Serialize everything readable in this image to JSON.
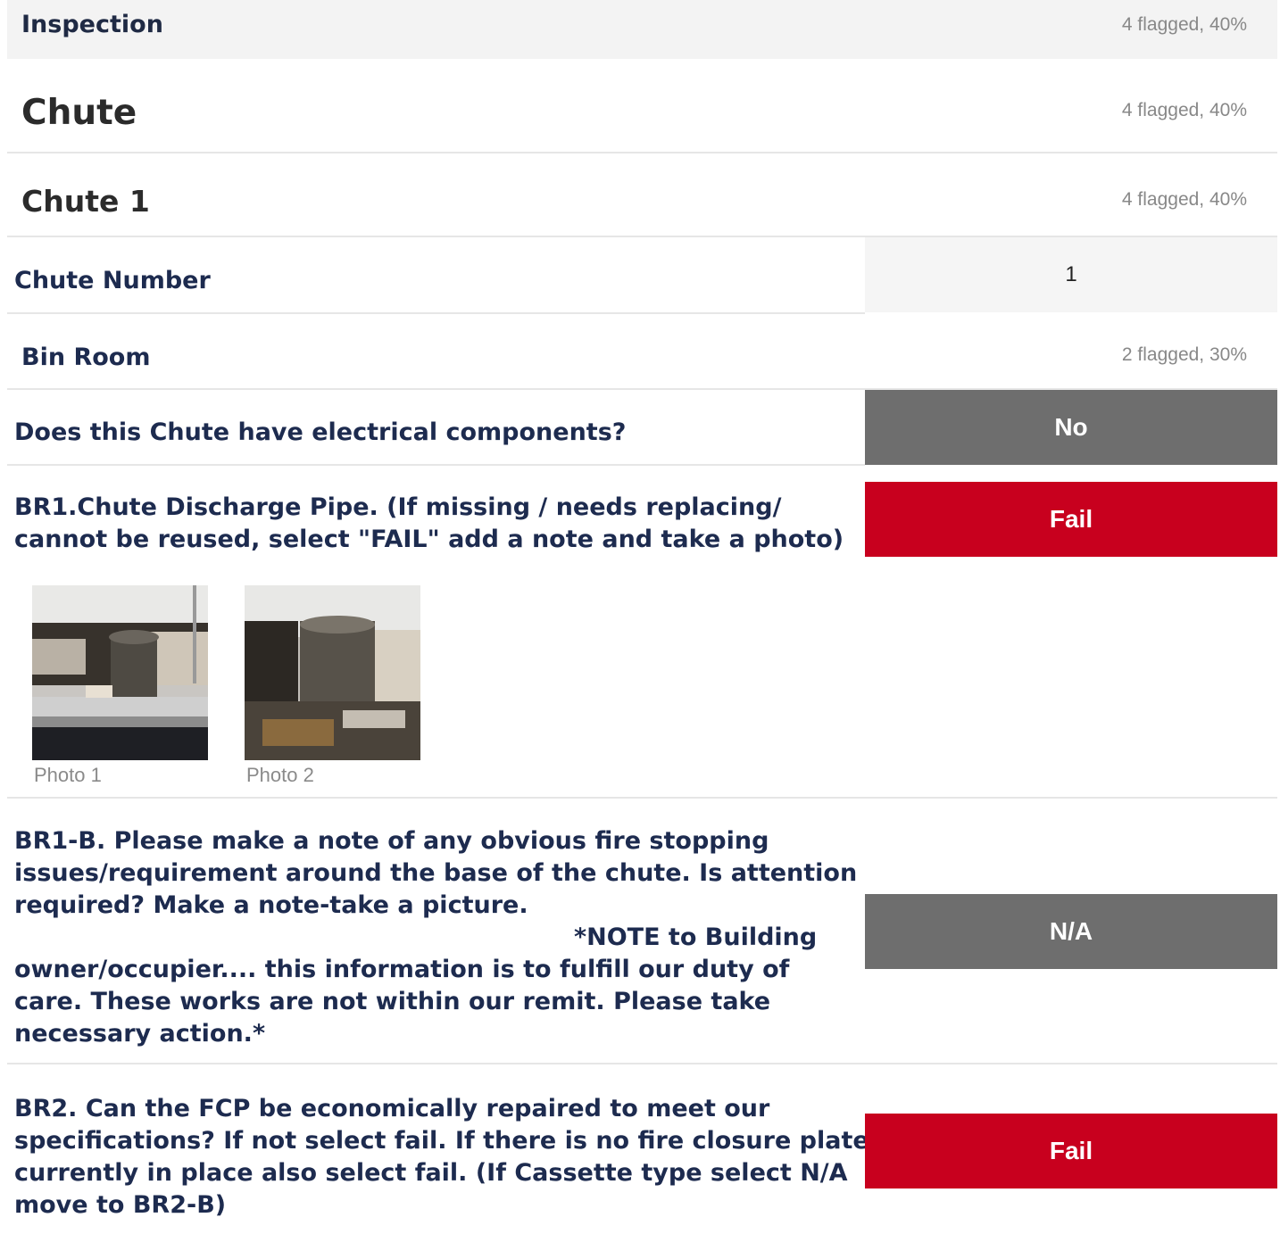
{
  "inspection": {
    "title": "Inspection",
    "status": "4 flagged, 40%"
  },
  "chute": {
    "title": "Chute",
    "status": "4 flagged, 40%"
  },
  "chute1": {
    "title": "Chute 1",
    "status": "4 flagged, 40%"
  },
  "chute_number": {
    "label": "Chute Number",
    "value": "1"
  },
  "bin_room": {
    "title": "Bin Room",
    "status": "2 flagged, 30%"
  },
  "electrical": {
    "question": "Does this Chute have electrical components?",
    "answer": "No"
  },
  "br1": {
    "question_line1": "BR1.Chute Discharge Pipe. (If missing / needs replacing/",
    "question_line2": "cannot be reused, select \"FAIL\" add a note and take a photo)",
    "answer": "Fail",
    "photos": [
      {
        "caption": "Photo 1"
      },
      {
        "caption": "Photo 2"
      }
    ]
  },
  "br1b": {
    "line1": "BR1-B. Please make a note of any obvious fire stopping",
    "line2": "issues/requirement around the base of the chute. Is attention",
    "line3": "required? Make a note-take a picture.",
    "line4": "*NOTE to Building",
    "line5": "owner/occupier.... this information is to fulfill our duty of",
    "line6": "care. These works are not within our remit. Please take",
    "line7": "necessary action.*",
    "answer": "N/A"
  },
  "br2": {
    "line1": "BR2. Can the FCP be economically repaired to meet our",
    "line2": "specifications? If not select fail. If there is no fire closure plate",
    "line3": "currently in place also select fail. (If Cassette type select N/A",
    "line4": "move to BR2-B)",
    "answer": "Fail"
  },
  "colors": {
    "fail": "#c8001e",
    "neutral": "#6e6e6e",
    "text": "#1d2b4f"
  }
}
